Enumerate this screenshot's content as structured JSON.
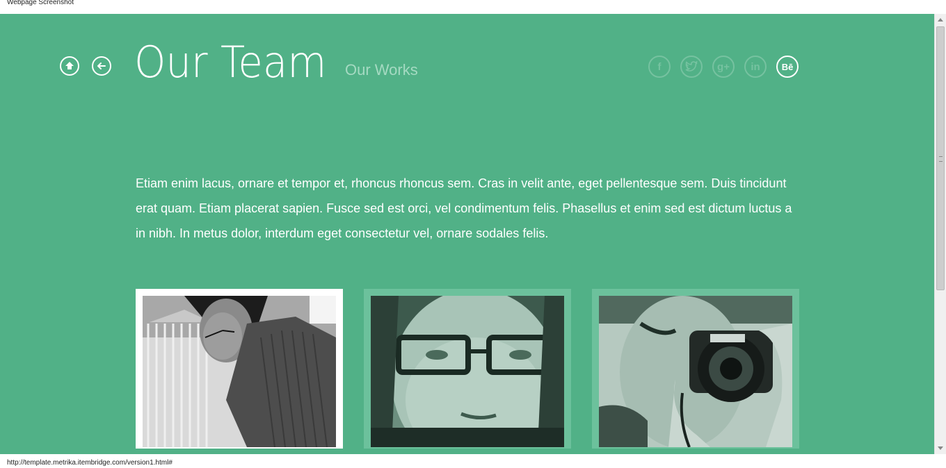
{
  "window": {
    "title": "Webpage Screenshot"
  },
  "status": {
    "url": "http://template.metrika.itembridge.com/version1.html#"
  },
  "header": {
    "title": "Our Team",
    "secondary_link": "Our Works",
    "nav": [
      {
        "icon": "home-icon"
      },
      {
        "icon": "back-arrow-icon"
      }
    ],
    "social": [
      {
        "name": "facebook",
        "icon": "f",
        "active": false
      },
      {
        "name": "twitter",
        "icon": "twitter-bird",
        "active": false
      },
      {
        "name": "google-plus",
        "icon": "g+",
        "active": false
      },
      {
        "name": "linkedin",
        "icon": "in",
        "active": false
      },
      {
        "name": "behance",
        "icon": "Bē",
        "active": true
      }
    ]
  },
  "intro": {
    "text": "Etiam enim lacus, ornare et tempor et, rhoncus rhoncus sem. Cras in velit ante, eget pellentesque sem. Duis tincidunt erat quam. Etiam placerat sapien. Fusce sed est orci, vel condimentum felis. Phasellus et enim sed est dictum luctus a in nibh. In metus dolor, interdum eget consectetur vel, ornare sodales felis."
  },
  "team": [
    {
      "photo": "man-looking-down-photo",
      "active": true
    },
    {
      "photo": "man-with-glasses-photo",
      "active": false
    },
    {
      "photo": "man-with-camera-photo",
      "active": false
    }
  ],
  "colors": {
    "background": "#51b187",
    "text": "#ffffff",
    "muted": "#a5dac2",
    "icon_muted": "#76c2a0"
  }
}
